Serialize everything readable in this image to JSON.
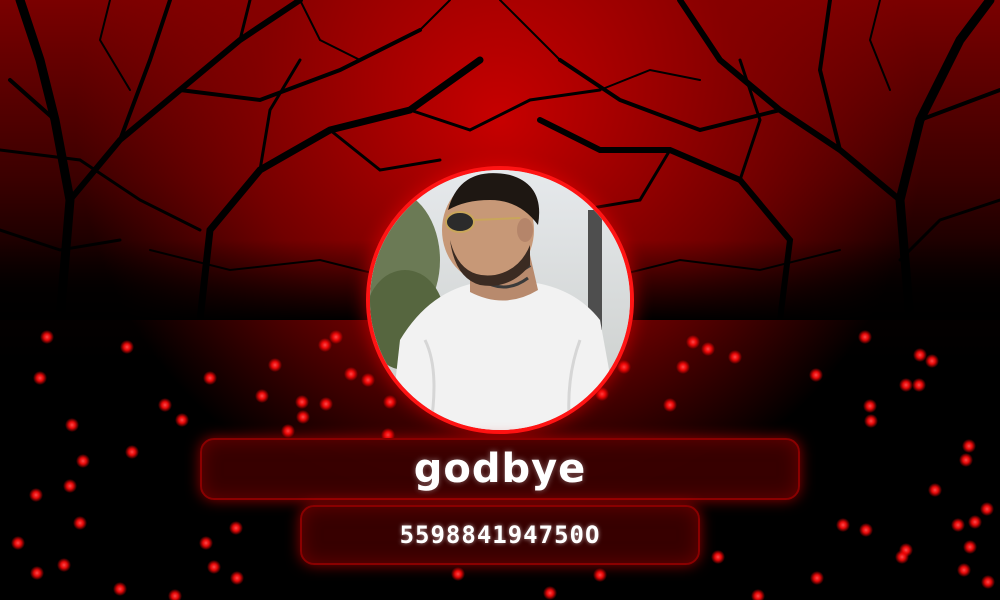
{
  "profile": {
    "username": "godbye",
    "user_id": "559884194750O"
  },
  "avatar": {
    "icon": "profile-photo-man-sunglasses-white-tshirt"
  },
  "background": {
    "description_icon": "red-sky-dead-trees",
    "accent_color": "#ff1414",
    "dot_color": "#ff1a1a"
  }
}
